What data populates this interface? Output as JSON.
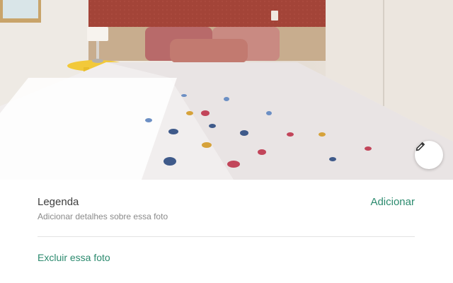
{
  "photo": {
    "description_icon": "bedroom-photo",
    "edit_icon": "pencil-icon"
  },
  "caption": {
    "title": "Legenda",
    "add_label": "Adicionar",
    "hint": "Adicionar detalhes sobre essa foto"
  },
  "actions": {
    "delete_label": "Excluir essa foto"
  },
  "colors": {
    "accent": "#2b8a6e",
    "title_text": "#3d3d3d",
    "hint_text": "#8a8a8a",
    "divider": "#e3e3e3"
  }
}
